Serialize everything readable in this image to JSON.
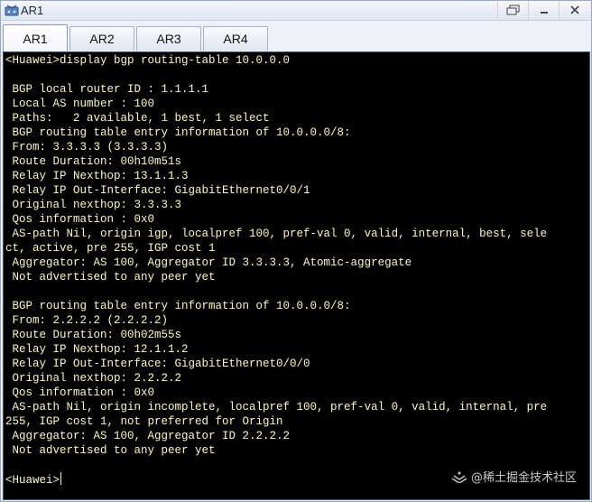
{
  "window": {
    "title": "AR1"
  },
  "tabs": [
    {
      "label": "AR1",
      "active": true
    },
    {
      "label": "AR2",
      "active": false
    },
    {
      "label": "AR3",
      "active": false
    },
    {
      "label": "AR4",
      "active": false
    }
  ],
  "terminal": {
    "lines": [
      "<Huawei>display bgp routing-table 10.0.0.0",
      "",
      " BGP local router ID : 1.1.1.1",
      " Local AS number : 100",
      " Paths:   2 available, 1 best, 1 select",
      " BGP routing table entry information of 10.0.0.0/8:",
      " From: 3.3.3.3 (3.3.3.3)",
      " Route Duration: 00h10m51s",
      " Relay IP Nexthop: 13.1.1.3",
      " Relay IP Out-Interface: GigabitEthernet0/0/1",
      " Original nexthop: 3.3.3.3",
      " Qos information : 0x0",
      " AS-path Nil, origin igp, localpref 100, pref-val 0, valid, internal, best, sele",
      "ct, active, pre 255, IGP cost 1",
      " Aggregator: AS 100, Aggregator ID 3.3.3.3, Atomic-aggregate",
      " Not advertised to any peer yet",
      "",
      " BGP routing table entry information of 10.0.0.0/8:",
      " From: 2.2.2.2 (2.2.2.2)",
      " Route Duration: 00h02m55s",
      " Relay IP Nexthop: 12.1.1.2",
      " Relay IP Out-Interface: GigabitEthernet0/0/0",
      " Original nexthop: 2.2.2.2",
      " Qos information : 0x0",
      " AS-path Nil, origin incomplete, localpref 100, pref-val 0, valid, internal, pre",
      "255, IGP cost 1, not preferred for Origin",
      " Aggregator: AS 100, Aggregator ID 2.2.2.2",
      " Not advertised to any peer yet",
      "",
      "<Huawei>"
    ]
  },
  "watermark": {
    "text": "@稀土掘金技术社区"
  },
  "colors": {
    "terminal_text": "#fdf8c2",
    "terminal_bg": "#000000"
  }
}
